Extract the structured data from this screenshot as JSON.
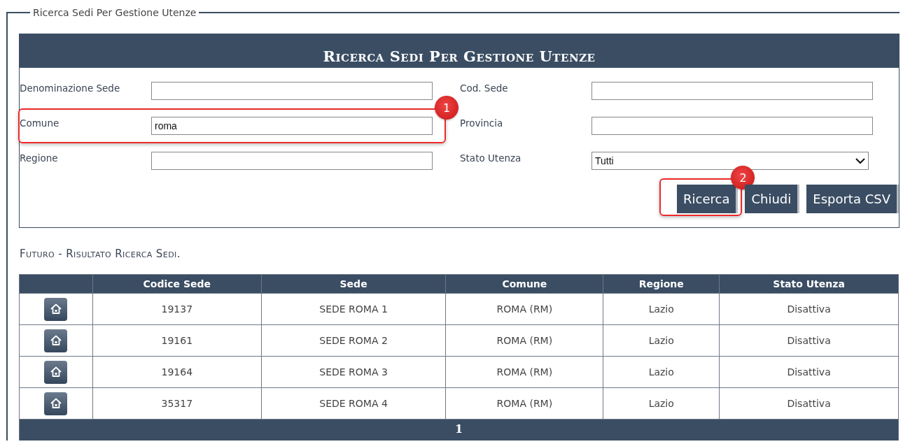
{
  "fieldset": {
    "legend": "Ricerca Sedi Per Gestione Utenze"
  },
  "search_panel": {
    "title": "Ricerca Sedi Per Gestione Utenze",
    "fields": [
      {
        "label": "Denominazione Sede",
        "kind": "text"
      },
      {
        "label": "Cod. Sede",
        "kind": "text"
      },
      {
        "label": "Comune",
        "kind": "text",
        "value": "roma",
        "callout": "1"
      },
      {
        "label": "Provincia",
        "kind": "text"
      },
      {
        "label": "Regione",
        "kind": "text"
      },
      {
        "label": "Stato Utenza",
        "kind": "select",
        "value": "Tutti"
      }
    ],
    "buttons": [
      {
        "label": "Ricerca",
        "callout": "2"
      },
      {
        "label": "Chiudi"
      },
      {
        "label": "Esporta CSV"
      }
    ]
  },
  "results": {
    "title": "Futuro - Risultato Ricerca Sedi.",
    "columns": [
      "Codice Sede",
      "Sede",
      "Comune",
      "Regione",
      "Stato Utenza"
    ],
    "rows": [
      {
        "cells": [
          "19137",
          "SEDE ROMA 1",
          "ROMA (RM)",
          "Lazio",
          "Disattiva"
        ]
      },
      {
        "cells": [
          "19161",
          "SEDE ROMA 2",
          "ROMA (RM)",
          "Lazio",
          "Disattiva"
        ]
      },
      {
        "cells": [
          "19164",
          "SEDE ROMA 3",
          "ROMA (RM)",
          "Lazio",
          "Disattiva"
        ]
      },
      {
        "cells": [
          "35317",
          "SEDE ROMA 4",
          "ROMA (RM)",
          "Lazio",
          "Disattiva"
        ]
      }
    ],
    "pager": [
      "1"
    ]
  }
}
